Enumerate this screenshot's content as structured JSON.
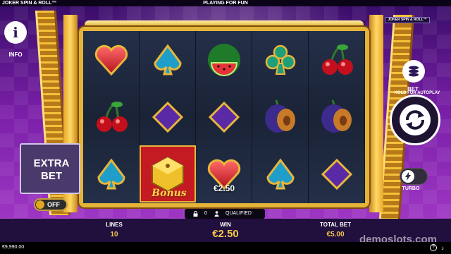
{
  "topbar": {
    "game_title": "JOKER SPIN & ROLL™",
    "mode": "PLAYING FOR FUN"
  },
  "brand_badge": "JOKER SPIN & ROLL™",
  "left_controls": {
    "info_glyph": "i",
    "info_label": "INFO",
    "extra_bet_line1": "EXTRA",
    "extra_bet_line2": "BET",
    "extra_bet_state": "OFF"
  },
  "right_controls": {
    "bet_label": "BET",
    "hold_text": "HOLD FOR AUTOPLAY",
    "turbo_label": "TURBO"
  },
  "reels": [
    [
      "heart",
      "cherry",
      "spade"
    ],
    [
      "spade",
      "diamond",
      "bonus"
    ],
    [
      "watermelon",
      "diamond",
      "heart"
    ],
    [
      "club",
      "plum",
      "spade"
    ],
    [
      "cherry",
      "plum",
      "diamond"
    ]
  ],
  "reel_win_label": "€2.50",
  "bonus_text": "Bonus",
  "status": {
    "count": "0",
    "qualified": "QUALIFIED"
  },
  "infobar": {
    "lines_label": "LINES",
    "lines_value": "10",
    "win_label": "WIN",
    "win_value": "€2.50",
    "total_bet_label": "TOTAL BET",
    "total_bet_value": "€5.00"
  },
  "footer": {
    "balance": "€9,990.00",
    "help_glyph": "?",
    "sound_glyph": "♪"
  },
  "watermark": "demoslots.com",
  "colors": {
    "gold": "#e4b43a",
    "purple_bg": "#7a1fa8",
    "win_gold": "#f5c84a"
  }
}
